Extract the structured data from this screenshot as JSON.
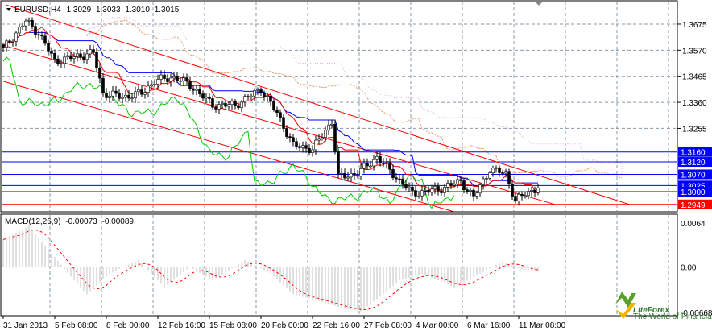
{
  "header": {
    "symbol": "EURUSD,H4",
    "open": "1.3029",
    "high": "1.3033",
    "low": "1.3010",
    "close": "1.3015"
  },
  "macd_header": {
    "label": "MACD(12,26,9)",
    "main": "-0.00073",
    "signal": "-0.00089"
  },
  "logo": {
    "text": "LiteForex",
    "tagline": "The World of Financial Freedom"
  },
  "colors": {
    "candle": "#000000",
    "level": "#0000ff",
    "channel": "#ff0000",
    "kijun": "#0000ff",
    "tenkan": "#ff0000",
    "chikou": "#00cc00",
    "cloud": "#d8b0d8",
    "hist": "#c0c0c0",
    "signal": "#ff0000",
    "red_level": "#ff0000"
  },
  "chart_data": {
    "type": "candlestick",
    "title": "EURUSD,H4",
    "ylim": [
      1.2919,
      1.3769
    ],
    "y_ticks": [
      "1.3675",
      "1.3570",
      "1.3465",
      "1.3360",
      "1.3255"
    ],
    "x_ticks": [
      "31 Jan 2013",
      "5 Feb 08:00",
      "8 Feb 00:00",
      "12 Feb 16:00",
      "15 Feb 08:00",
      "20 Feb 00:00",
      "22 Feb 16:00",
      "27 Feb 08:00",
      "4 Mar 00:00",
      "6 Mar 16:00",
      "11 Mar 08:00"
    ],
    "bars_per_tick": 16,
    "close_keypoints": [
      [
        0,
        1.3575
      ],
      [
        7,
        1.3688
      ],
      [
        11,
        1.3639
      ],
      [
        16,
        1.3526
      ],
      [
        22,
        1.3543
      ],
      [
        28,
        1.3559
      ],
      [
        31,
        1.3397
      ],
      [
        37,
        1.3381
      ],
      [
        43,
        1.3397
      ],
      [
        47,
        1.3446
      ],
      [
        53,
        1.3462
      ],
      [
        58,
        1.3429
      ],
      [
        65,
        1.3349
      ],
      [
        72,
        1.3349
      ],
      [
        80,
        1.3413
      ],
      [
        85,
        1.3316
      ],
      [
        90,
        1.3187
      ],
      [
        96,
        1.3171
      ],
      [
        102,
        1.3284
      ],
      [
        104,
        1.3058
      ],
      [
        110,
        1.3074
      ],
      [
        116,
        1.3139
      ],
      [
        122,
        1.3058
      ],
      [
        127,
        1.2993
      ],
      [
        135,
        1.3009
      ],
      [
        142,
        1.3042
      ],
      [
        146,
        1.2977
      ],
      [
        151,
        1.309
      ],
      [
        156,
        1.3074
      ],
      [
        159,
        1.2961
      ],
      [
        162,
        1.2993
      ],
      [
        166,
        1.3015
      ]
    ],
    "levels": [
      {
        "price": "1.3160",
        "color": "#0000ff"
      },
      {
        "price": "1.3120",
        "color": "#0000ff"
      },
      {
        "price": "1.3070",
        "color": "#0000ff"
      },
      {
        "price": "1.3025",
        "color": "#0000ff"
      },
      {
        "price": "1.3000",
        "color": "#0000ff"
      },
      {
        "price": "1.2949",
        "color": "#ff0000"
      }
    ],
    "channel_lines": [
      [
        [
          1,
          1.3752
        ],
        [
          195,
          1.2946
        ]
      ],
      [
        [
          0,
          1.359
        ],
        [
          172,
          1.2946
        ]
      ],
      [
        [
          0,
          1.3445
        ],
        [
          140,
          1.2919
        ]
      ]
    ],
    "macd": {
      "ylim": [
        -0.00668,
        0.0064
      ],
      "y_ticks": [
        "0.0064",
        "0.00",
        "-0.00668"
      ],
      "hist_keypoints": [
        [
          0,
          0.004
        ],
        [
          8,
          0.006
        ],
        [
          15,
          0.002
        ],
        [
          22,
          -0.002
        ],
        [
          26,
          -0.004
        ],
        [
          33,
          -0.001
        ],
        [
          42,
          0.001
        ],
        [
          50,
          -0.003
        ],
        [
          58,
          0.0
        ],
        [
          65,
          -0.002
        ],
        [
          75,
          0.001
        ],
        [
          83,
          -0.001
        ],
        [
          90,
          -0.004
        ],
        [
          98,
          -0.005
        ],
        [
          105,
          -0.006
        ],
        [
          111,
          -0.0065
        ],
        [
          118,
          -0.004
        ],
        [
          123,
          -0.002
        ],
        [
          130,
          -0.001
        ],
        [
          140,
          -0.003
        ],
        [
          148,
          -0.001
        ],
        [
          155,
          0.0008
        ],
        [
          160,
          -0.0002
        ],
        [
          166,
          -0.0007
        ]
      ]
    }
  }
}
